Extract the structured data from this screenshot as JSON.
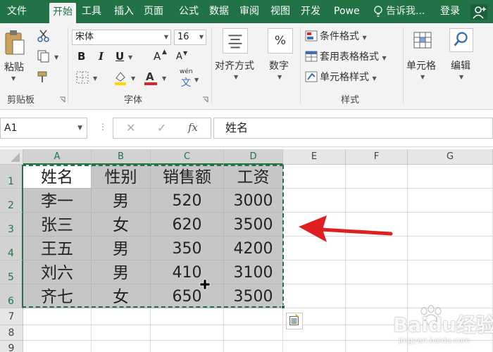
{
  "ribbon_tabs": [
    {
      "label": "文件",
      "active": false
    },
    {
      "label": "开始",
      "active": true
    },
    {
      "label": "工具",
      "active": false
    },
    {
      "label": "插入",
      "active": false
    },
    {
      "label": "页面",
      "active": false
    },
    {
      "label": "公式",
      "active": false
    },
    {
      "label": "数据",
      "active": false
    },
    {
      "label": "审阅",
      "active": false
    },
    {
      "label": "视图",
      "active": false
    },
    {
      "label": "开发",
      "active": false
    },
    {
      "label": "Powe",
      "active": false
    }
  ],
  "tell_me": "告诉我...",
  "login": "登录",
  "ribbon": {
    "clipboard": {
      "paste_label": "粘贴",
      "group_label": "剪贴板"
    },
    "font": {
      "font_name": "宋体",
      "font_size": "16",
      "group_label": "字体",
      "bold": "B",
      "italic": "I",
      "underline": "U",
      "grow": "A",
      "shrink": "A",
      "phonetic": "wén"
    },
    "alignment": {
      "label": "对齐方式"
    },
    "number": {
      "label": "数字",
      "icon_text": "%"
    },
    "styles": {
      "conditional_format": "条件格式",
      "table_format": "套用表格格式",
      "cell_styles": "单元格样式",
      "group_label": "样式"
    },
    "cells": {
      "label": "单元格"
    },
    "editing": {
      "label": "编辑"
    }
  },
  "formula_bar": {
    "name_box": "A1",
    "fx": "fx",
    "content": "姓名"
  },
  "columns": [
    "A",
    "B",
    "C",
    "D",
    "E",
    "F",
    "G"
  ],
  "rows": [
    "1",
    "2",
    "3",
    "4",
    "5",
    "6",
    "7",
    "8",
    "9"
  ],
  "table": {
    "header": [
      "姓名",
      "性别",
      "销售额",
      "工资"
    ],
    "data": [
      [
        "李一",
        "男",
        "520",
        "3000"
      ],
      [
        "张三",
        "女",
        "620",
        "3500"
      ],
      [
        "王五",
        "男",
        "350",
        "4200"
      ],
      [
        "刘六",
        "男",
        "410",
        "3100"
      ],
      [
        "齐七",
        "女",
        "650",
        "3500"
      ]
    ]
  },
  "selection": {
    "range": "A1:D6",
    "active_cell": "A1"
  },
  "colors": {
    "accent": "#217346",
    "arrow": "#e02020",
    "selection_fill": "#c6c6c6"
  },
  "watermark": {
    "brand": "Baidu经验",
    "url": "jingyan.baidu.com"
  }
}
